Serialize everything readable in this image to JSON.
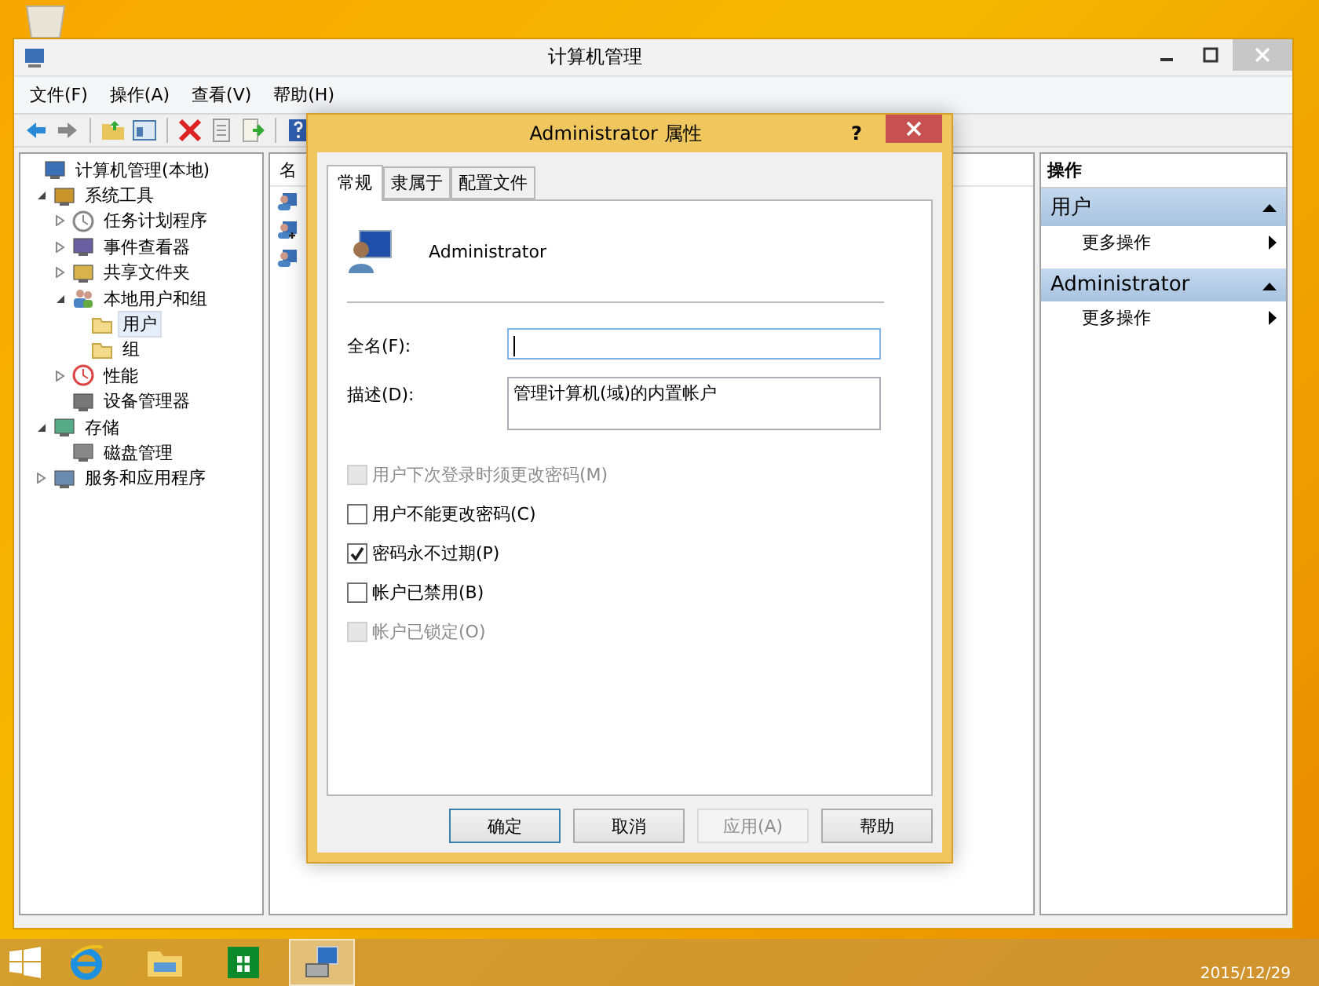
{
  "window": {
    "title": "计算机管理"
  },
  "menu": [
    "文件(F)",
    "操作(A)",
    "查看(V)",
    "帮助(H)"
  ],
  "tree": [
    {
      "label": "计算机管理(本地)",
      "kind": "computer",
      "children": [
        {
          "label": "系统工具",
          "kind": "tools",
          "expanded": true,
          "children": [
            {
              "label": "任务计划程序",
              "kind": "clock",
              "expanded": false
            },
            {
              "label": "事件查看器",
              "kind": "log",
              "expanded": false
            },
            {
              "label": "共享文件夹",
              "kind": "share",
              "expanded": false
            },
            {
              "label": "本地用户和组",
              "kind": "users",
              "expanded": true,
              "children": [
                {
                  "label": "用户",
                  "kind": "folder",
                  "selected": true
                },
                {
                  "label": "组",
                  "kind": "folder",
                  "selected": false
                }
              ]
            },
            {
              "label": "性能",
              "kind": "perf",
              "expanded": false
            },
            {
              "label": "设备管理器",
              "kind": "device"
            }
          ]
        },
        {
          "label": "存储",
          "kind": "storage",
          "expanded": true,
          "children": [
            {
              "label": "磁盘管理",
              "kind": "disk"
            }
          ]
        },
        {
          "label": "服务和应用程序",
          "kind": "services",
          "expanded": false
        }
      ]
    }
  ],
  "list": {
    "column": "名",
    "rows": [
      {
        "kind": "user"
      },
      {
        "kind": "guest"
      },
      {
        "kind": "user"
      }
    ]
  },
  "actions": {
    "header": "操作",
    "sections": [
      {
        "title": "用户",
        "items": [
          "更多操作"
        ]
      },
      {
        "title": "Administrator",
        "items": [
          "更多操作"
        ]
      }
    ]
  },
  "dialog": {
    "title": "Administrator 属性",
    "help": "?",
    "tabs": [
      {
        "label": "常规",
        "selected": true
      },
      {
        "label": "隶属于",
        "selected": false
      },
      {
        "label": "配置文件",
        "selected": false
      }
    ],
    "user": "Administrator",
    "fields": [
      {
        "label": "全名(F):",
        "focused": true,
        "multiline": false
      },
      {
        "label": "描述(D):",
        "value": "管理计算机(域)的内置帐户",
        "focused": false,
        "multiline": true
      }
    ],
    "checkboxes": [
      {
        "label": "用户下次登录时须更改密码(M)",
        "checked": false,
        "disabled": true
      },
      {
        "label": "用户不能更改密码(C)",
        "checked": false,
        "disabled": false
      },
      {
        "label": "密码永不过期(P)",
        "checked": true,
        "disabled": false
      },
      {
        "label": "帐户已禁用(B)",
        "checked": false,
        "disabled": false
      },
      {
        "label": "帐户已锁定(O)",
        "checked": false,
        "disabled": true
      }
    ],
    "buttons": [
      {
        "label": "确定",
        "default": true,
        "disabled": false
      },
      {
        "label": "取消",
        "default": false,
        "disabled": false
      },
      {
        "label": "应用(A)",
        "default": false,
        "disabled": true
      },
      {
        "label": "帮助",
        "default": false,
        "disabled": false
      }
    ]
  },
  "taskbar": {
    "apps": [
      {
        "kind": "ie",
        "active": false
      },
      {
        "kind": "explorer",
        "active": false
      },
      {
        "kind": "store",
        "active": false
      },
      {
        "kind": "compmgmt",
        "active": true
      }
    ],
    "date": "2015/12/29"
  }
}
